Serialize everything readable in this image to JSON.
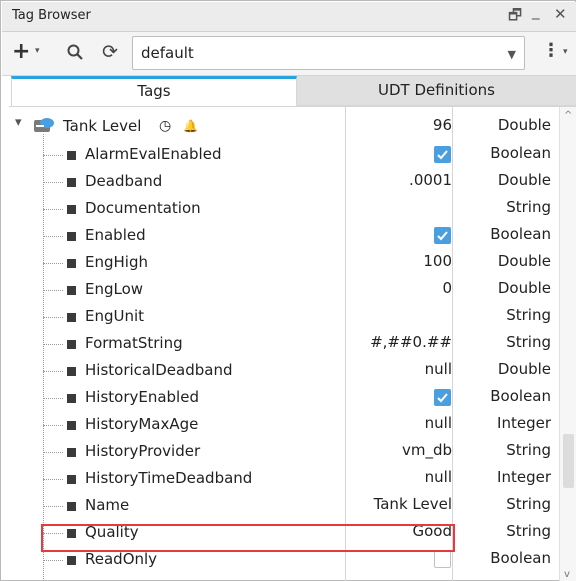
{
  "window": {
    "title": "Tag Browser",
    "restore_glyph": "🗗",
    "minimize_glyph": "_",
    "close_glyph": "✕"
  },
  "toolbar": {
    "add_glyph": "+",
    "refresh_glyph": "⟳",
    "more_glyph": "⋮",
    "caret_glyph": "▾",
    "provider_value": "default",
    "provider_arrow": "▼"
  },
  "tabs": [
    {
      "label": "Tags"
    },
    {
      "label": "UDT Definitions"
    }
  ],
  "tree": {
    "root": {
      "label": "Tank Level",
      "value": "96",
      "type": "Double",
      "expand_glyph": "▾",
      "clock_glyph": "◷",
      "bell_glyph": "🔔"
    },
    "rows": [
      {
        "label": "AlarmEvalEnabled",
        "value": "",
        "checked": true,
        "type": "Boolean"
      },
      {
        "label": "Deadband",
        "value": ".0001",
        "type": "Double"
      },
      {
        "label": "Documentation",
        "value": "",
        "type": "String"
      },
      {
        "label": "Enabled",
        "value": "",
        "checked": true,
        "type": "Boolean"
      },
      {
        "label": "EngHigh",
        "value": "100",
        "type": "Double"
      },
      {
        "label": "EngLow",
        "value": "0",
        "type": "Double"
      },
      {
        "label": "EngUnit",
        "value": "",
        "type": "String"
      },
      {
        "label": "FormatString",
        "value": "#,##0.##",
        "type": "String"
      },
      {
        "label": "HistoricalDeadband",
        "value": "null",
        "type": "Double"
      },
      {
        "label": "HistoryEnabled",
        "value": "",
        "checked": true,
        "type": "Boolean"
      },
      {
        "label": "HistoryMaxAge",
        "value": "null",
        "type": "Integer"
      },
      {
        "label": "HistoryProvider",
        "value": "vm_db",
        "type": "String"
      },
      {
        "label": "HistoryTimeDeadband",
        "value": "null",
        "type": "Integer"
      },
      {
        "label": "Name",
        "value": "Tank Level",
        "type": "String"
      },
      {
        "label": "Quality",
        "value": "Good",
        "type": "String",
        "highlighted": true
      },
      {
        "label": "ReadOnly",
        "value": "",
        "checked": false,
        "type": "Boolean"
      }
    ]
  },
  "scrollbar": {
    "up_glyph": "^",
    "down_glyph": "v"
  },
  "colors": {
    "accent": "#29a3e0",
    "checkbox": "#4a9fe0",
    "highlight": "#e83a3a"
  }
}
